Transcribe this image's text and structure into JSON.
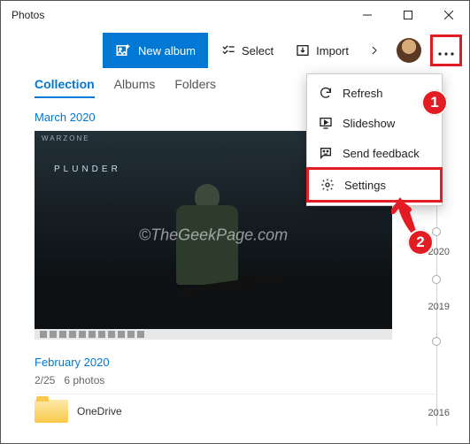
{
  "window": {
    "title": "Photos"
  },
  "toolbar": {
    "new_album": "New album",
    "select": "Select",
    "import": "Import"
  },
  "tabs": {
    "collection": "Collection",
    "albums": "Albums",
    "folders": "Folders"
  },
  "sections": {
    "march": {
      "header": "March 2020",
      "watermark": "©TheGeekPage.com",
      "hud": "WARZONE",
      "mode": "PLUNDER"
    },
    "february": {
      "header": "February 2020",
      "subline_date": "2/25",
      "subline_count": "6 photos",
      "folder": "OneDrive"
    }
  },
  "timeline": {
    "y2020": "2020",
    "y2019": "2019",
    "y2016": "2016"
  },
  "menu": {
    "refresh": "Refresh",
    "slideshow": "Slideshow",
    "feedback": "Send feedback",
    "settings": "Settings"
  },
  "annotations": {
    "one": "1",
    "two": "2"
  }
}
